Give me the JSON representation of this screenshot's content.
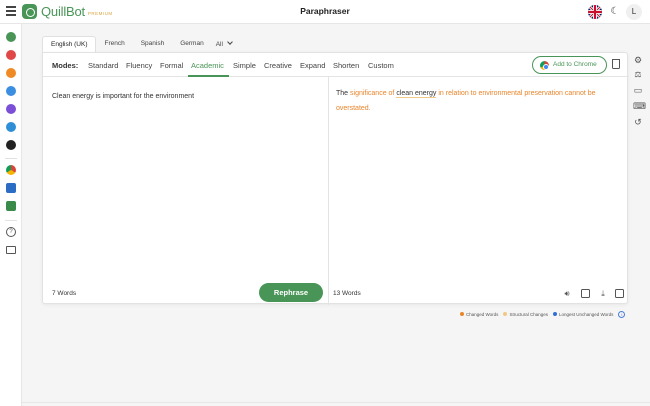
{
  "header": {
    "brand": "QuillBot",
    "brand_tier": "PREMIUM",
    "title": "Paraphraser",
    "avatar_initial": "L"
  },
  "languages": {
    "tabs": [
      {
        "label": "English (UK)",
        "active": true
      },
      {
        "label": "French",
        "active": false
      },
      {
        "label": "Spanish",
        "active": false
      },
      {
        "label": "German",
        "active": false
      }
    ],
    "more_label": "All"
  },
  "modes": {
    "label": "Modes:",
    "items": [
      "Standard",
      "Fluency",
      "Formal",
      "Academic",
      "Simple",
      "Creative",
      "Expand",
      "Shorten",
      "Custom"
    ],
    "active": "Academic"
  },
  "chrome_button": "Add to Chrome",
  "input": {
    "text": "Clean energy is important for the environment",
    "word_count": "7 Words"
  },
  "rephrase_button": "Rephrase",
  "output": {
    "segments": [
      {
        "text": "The ",
        "type": "plain"
      },
      {
        "text": "significance of",
        "type": "changed"
      },
      {
        "text": " ",
        "type": "plain"
      },
      {
        "text": "clean energy",
        "type": "unchanged-long"
      },
      {
        "text": " in relation to environmental preservation cannot be overstated.",
        "type": "changed"
      }
    ],
    "word_count": "13 Words"
  },
  "legend": {
    "items": [
      {
        "label": "Changed Words",
        "color": "#e8852b"
      },
      {
        "label": "Structural Changes",
        "color": "#f0c987"
      },
      {
        "label": "Longest Unchanged Words",
        "color": "#2f6fd6"
      }
    ]
  },
  "colors": {
    "accent": "#499557",
    "changed": "#e8852b"
  },
  "icons": {
    "left_rail": [
      "paraphraser-icon",
      "grammar-icon",
      "ai-detector-icon",
      "summarizer-icon",
      "citation-icon",
      "translator-icon",
      "ai-humanizer-icon",
      "chrome-extension-icon",
      "word-addin-icon",
      "mac-app-icon",
      "help-icon",
      "mail-icon"
    ],
    "right_rail": [
      "settings-icon",
      "compare-modes-icon",
      "feedback-icon",
      "keyboard-icon",
      "history-icon"
    ]
  }
}
